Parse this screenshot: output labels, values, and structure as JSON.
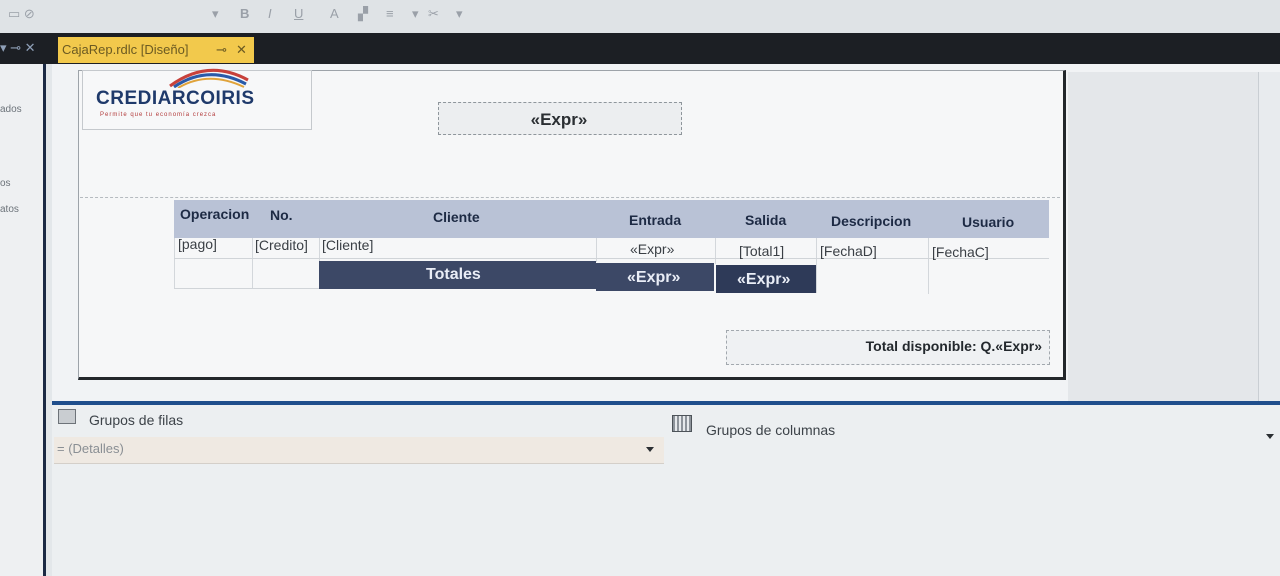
{
  "toolbar": {
    "bold": "B",
    "italic": "I",
    "underline": "U"
  },
  "tab": {
    "title": "CajaRep.rdlc [Diseño]",
    "pin": "⊸",
    "close": "✕"
  },
  "left_panel": {
    "items": [
      "ados",
      "os",
      "atos"
    ]
  },
  "report": {
    "logo": {
      "name": "CREDIARCOIRIS",
      "tagline": "Permite que tu economía crezca"
    },
    "title_expr": "«Expr»",
    "columns": [
      "Operacion",
      "No.",
      "Cliente",
      "Entrada",
      "Salida",
      "Descripcion",
      "Usuario"
    ],
    "detail_row": [
      "[pago]",
      "[Credito]",
      "[Cliente]",
      "«Expr»",
      "[Total1]",
      "[FechaD]",
      "[FechaC]"
    ],
    "totals": {
      "label": "Totales",
      "entrada": "«Expr»",
      "salida": "«Expr»"
    },
    "total_disponible": "Total disponible: Q.«Expr»"
  },
  "groups": {
    "rows_label": "Grupos de filas",
    "cols_label": "Grupos de columnas",
    "detalles": "= (Detalles)"
  },
  "colors": {
    "tab_active": "#f2c94c",
    "header_row": "#b9c2d6",
    "totals_bg": "#3c4866",
    "splitter": "#1f4e8c"
  }
}
